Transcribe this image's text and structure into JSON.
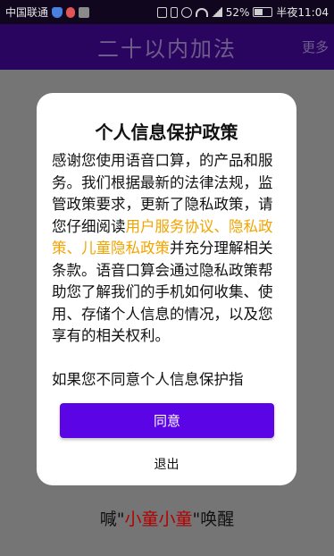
{
  "status_bar": {
    "carrier": "中国联通",
    "battery_percent": "52%",
    "battery_level": 0.52,
    "time": "半夜11:04",
    "left_icons": [
      "shield-icon",
      "mic-icon",
      "image-icon"
    ],
    "right_icons": [
      "nfc-icon",
      "vibrate-icon",
      "alarm-icon",
      "wifi-icon",
      "signal-icon",
      "battery-icon"
    ]
  },
  "app_bar": {
    "title": "二十以内加法",
    "more_label": "更多"
  },
  "background": {
    "wake_prefix": "喊\"",
    "wake_word": "小童小童",
    "wake_suffix": "\"唤醒"
  },
  "dialog": {
    "title": "个人信息保护政策",
    "body_before_links": "感谢您使用语音口算，的产品和服务。我们根据最新的法律法规，监管政策要求，更新了隐私政策，请您仔细阅读",
    "link_user_agreement": "用户服务协议",
    "sep1": "、",
    "link_privacy_policy": "隐私政策",
    "sep2": "、",
    "link_child_privacy": "儿童隐私政策",
    "body_after_links": "并充分理解相关条款。语音口算会通过隐私政策帮助您了解我们的手机如何收集、使用、存储个人信息的情况，以及您享有的相关权利。",
    "body_para2": "如果您不同意个人信息保护指",
    "agree_label": "同意",
    "exit_label": "退出"
  },
  "colors": {
    "status_bar_bg": "#10071f",
    "app_bar_bg": "#2a0560",
    "overlay_bg": "#757575",
    "agree_button": "#5b05e6",
    "link": "#f0a400",
    "wake_word": "#b20000"
  }
}
